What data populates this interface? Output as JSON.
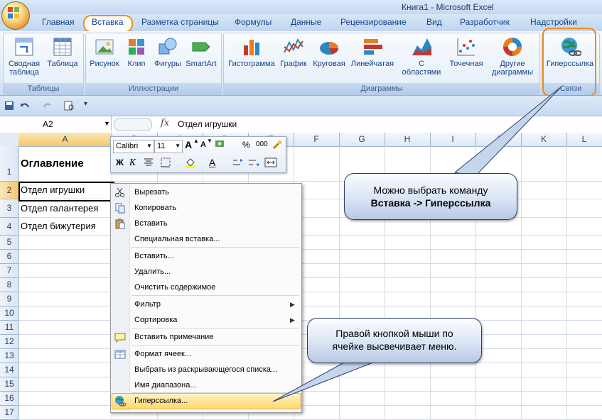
{
  "window": {
    "title": "Книга1 - Microsoft Excel"
  },
  "tabs": [
    "Главная",
    "Вставка",
    "Разметка страницы",
    "Формулы",
    "Данные",
    "Рецензирование",
    "Вид",
    "Разработчик",
    "Надстройки"
  ],
  "active_tab": "Вставка",
  "ribbon": {
    "groups": {
      "tables": "Таблицы",
      "illustrations": "Иллюстрации",
      "charts": "Диаграммы",
      "links": "Связи"
    },
    "buttons": {
      "pivot_l1": "Сводная",
      "pivot_l2": "таблица",
      "table": "Таблица",
      "picture": "Рисунок",
      "clip": "Клип",
      "shapes": "Фигуры",
      "smartart": "SmartArt",
      "histogram": "Гистограмма",
      "line": "График",
      "pie": "Круговая",
      "bar": "Линейчатая",
      "area_l1": "С",
      "area_l2": "областями",
      "scatter": "Точечная",
      "other_l1": "Другие",
      "other_l2": "диаграммы",
      "hyperlink": "Гиперссылка"
    }
  },
  "formula_bar": {
    "name_box": "A2",
    "fx": "fx",
    "formula": "Отдел игрушки"
  },
  "columns": [
    "A",
    "B",
    "C",
    "D",
    "E",
    "F",
    "G",
    "H",
    "I",
    "J",
    "K",
    "L"
  ],
  "rows": [
    "1",
    "2",
    "3",
    "4",
    "5",
    "6",
    "7",
    "8",
    "9",
    "10",
    "11",
    "12",
    "13",
    "14",
    "15",
    "16",
    "17"
  ],
  "cells": {
    "A1": "Оглавление",
    "A2": "Отдел игрушки",
    "A3": "Отдел галантерея",
    "A4": "Отдел бижутерия"
  },
  "mini_toolbar": {
    "font": "Calibri",
    "size": "11",
    "grow": "A",
    "shrink": "A",
    "percent": "%",
    "thousands": "000",
    "bold": "Ж",
    "italic": "К",
    "font_color": "A"
  },
  "context_menu": {
    "cut": "Вырезать",
    "copy": "Копировать",
    "paste": "Вставить",
    "paste_special": "Специальная вставка...",
    "insert": "Вставить...",
    "delete": "Удалить...",
    "clear": "Очистить содержимое",
    "filter": "Фильтр",
    "sort": "Сортировка",
    "insert_comment": "Вставить примечание",
    "format_cells": "Формат ячеек...",
    "pick_from_list": "Выбрать из раскрывающегося списка...",
    "name_range": "Имя диапазона...",
    "hyperlink": "Гиперссылка..."
  },
  "callouts": {
    "top_line1": "Можно выбрать команду",
    "top_line2": "Вставка -> Гиперссылка",
    "bottom_line1": "Правой кнопкой мыши по",
    "bottom_line2": "ячейке высвечивает меню."
  },
  "colors": {
    "highlight": "#f28a1e",
    "ribbon_text": "#15428b",
    "menu_hover": "#ffd76e"
  }
}
